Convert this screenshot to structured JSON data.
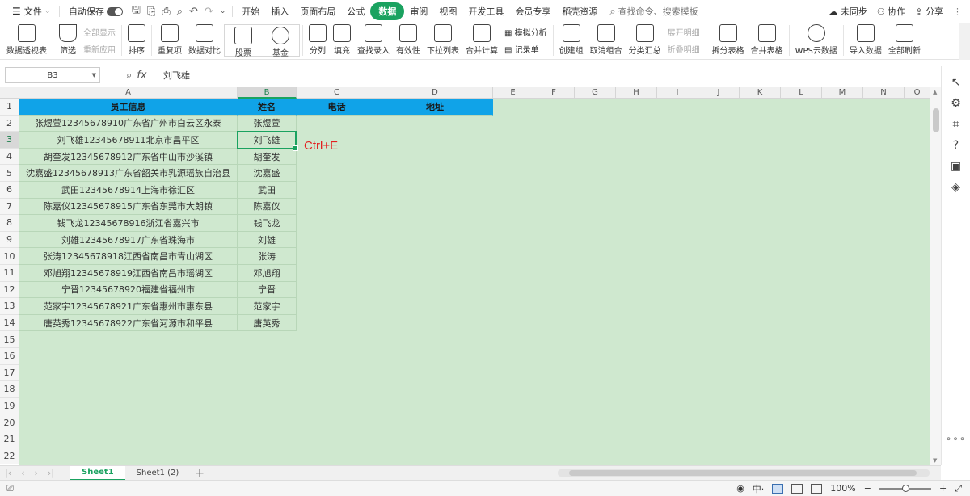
{
  "menubar": {
    "file_menu": "文件",
    "autosave_label": "自动保存",
    "menus": [
      "开始",
      "插入",
      "页面布局",
      "公式",
      "数据",
      "审阅",
      "视图",
      "开发工具",
      "会员专享",
      "稻壳资源"
    ],
    "active_menu": "数据",
    "search_placeholder": "查找命令、搜索模板",
    "sync": "未同步",
    "collab": "协作",
    "share": "分享"
  },
  "ribbon": {
    "pivot": "数据透视表",
    "filter": "筛选",
    "show_all": "全部显示",
    "reapply": "重新应用",
    "sort": "排序",
    "duplicates": "重复项",
    "compare": "数据对比",
    "stock": "股票",
    "fund": "基金",
    "split": "分列",
    "fill": "填充",
    "lookup": "查找录入",
    "validity": "有效性",
    "dropdown": "下拉列表",
    "consolidate": "合并计算",
    "simulate": "模拟分析",
    "record": "记录单",
    "group": "创建组",
    "ungroup": "取消组合",
    "subtotal": "分类汇总",
    "expand": "展开明细",
    "collapse": "折叠明细",
    "split_table": "拆分表格",
    "merge_table": "合并表格",
    "wps_cloud": "WPS云数据",
    "import": "导入数据",
    "refresh": "全部刷新"
  },
  "formula_bar": {
    "name_box": "B3",
    "value": "刘飞雄"
  },
  "grid": {
    "columns": [
      "A",
      "B",
      "C",
      "D",
      "E",
      "F",
      "G",
      "H",
      "I",
      "J",
      "K",
      "L",
      "M",
      "N",
      "O"
    ],
    "selected_column": "B",
    "selected_row": "3",
    "row_numbers": [
      "1",
      "2",
      "3",
      "4",
      "5",
      "6",
      "7",
      "8",
      "9",
      "10",
      "11",
      "12",
      "13",
      "14",
      "15",
      "16",
      "17",
      "18",
      "19",
      "20",
      "21",
      "22"
    ],
    "header": [
      "员工信息",
      "姓名",
      "电话",
      "地址"
    ],
    "rows": [
      [
        "张煜萱12345678910广东省广州市白云区永泰",
        "张煜萱"
      ],
      [
        "刘飞雄12345678911北京市昌平区",
        "刘飞雄"
      ],
      [
        "胡奎发12345678912广东省中山市沙溪镇",
        "胡奎发"
      ],
      [
        "沈嘉盛12345678913广东省韶关市乳源瑶族自治县",
        "沈嘉盛"
      ],
      [
        "武田12345678914上海市徐汇区",
        "武田"
      ],
      [
        "陈嘉仪12345678915广东省东莞市大朗镇",
        "陈嘉仪"
      ],
      [
        "钱飞龙12345678916浙江省嘉兴市",
        "钱飞龙"
      ],
      [
        "刘雄12345678917广东省珠海市",
        "刘雄"
      ],
      [
        "张涛12345678918江西省南昌市青山湖区",
        "张涛"
      ],
      [
        "邓旭翔12345678919江西省南昌市瑶湖区",
        "邓旭翔"
      ],
      [
        "宁晋12345678920福建省福州市",
        "宁晋"
      ],
      [
        "范家宇12345678921广东省惠州市惠东县",
        "范家宇"
      ],
      [
        "唐英秀12345678922广东省河源市和平县",
        "唐英秀"
      ]
    ],
    "hint": "Ctrl+E"
  },
  "tabs": {
    "sheets": [
      "Sheet1",
      "Sheet1 (2)"
    ],
    "active": "Sheet1"
  },
  "status": {
    "zoom": "100%"
  },
  "colors": {
    "accent": "#1aa260",
    "header_fill": "#10a3e8",
    "cell_fill": "#cfe8cf",
    "hint": "#e32020"
  }
}
